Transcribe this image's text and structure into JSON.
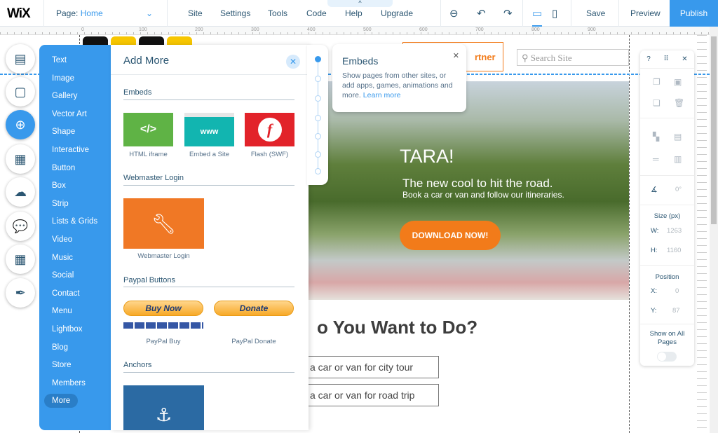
{
  "topbar": {
    "logo": "WiX",
    "page_label": "Page:",
    "page_value": "Home",
    "menu": [
      "Site",
      "Settings",
      "Tools",
      "Code",
      "Help",
      "Upgrade"
    ],
    "save": "Save",
    "preview": "Preview",
    "publish": "Publish",
    "accent": "#3899ec"
  },
  "ruler": [
    "0",
    "100",
    "200",
    "300",
    "400",
    "500",
    "600",
    "700",
    "800",
    "900"
  ],
  "add_panel": {
    "title": "Add More",
    "categories": [
      "Text",
      "Image",
      "Gallery",
      "Vector Art",
      "Shape",
      "Interactive",
      "Button",
      "Box",
      "Strip",
      "Lists & Grids",
      "Video",
      "Music",
      "Social",
      "Contact",
      "Menu",
      "Lightbox",
      "Blog",
      "Store",
      "Members",
      "More"
    ],
    "sections": {
      "embeds": "Embeds",
      "webmaster": "Webmaster Login",
      "paypal": "Paypal Buttons",
      "anchors": "Anchors"
    },
    "embeds": [
      {
        "icon": "</>",
        "label": "HTML iframe"
      },
      {
        "icon": "www",
        "label": "Embed a Site"
      },
      {
        "icon": "f",
        "label": "Flash (SWF)"
      }
    ],
    "webmaster_item": "Webmaster Login",
    "paypal": [
      {
        "button": "Buy Now",
        "label": "PayPal Buy"
      },
      {
        "button": "Donate",
        "label": "PayPal Donate"
      }
    ]
  },
  "tooltip": {
    "title": "Embeds",
    "body": "Show pages from other sites, or add apps, games, animations and more.",
    "link": "Learn more"
  },
  "site": {
    "partner": "rtner",
    "search_placeholder": "Search Site",
    "hero_title": "TARA!",
    "hero_sub": "The new cool to hit the road.",
    "hero_sub2": "Book a car or van and follow our itineraries.",
    "cta": "DOWNLOAD NOW!",
    "question": "o You Want to Do?",
    "choices": [
      "a car or van for city tour",
      "a car or van for road trip"
    ]
  },
  "inspector": {
    "help": "?",
    "size_label": "Size (px)",
    "w_label": "W:",
    "w": "1263",
    "h_label": "H:",
    "h": "1160",
    "rotation": "0°",
    "position_label": "Position",
    "x_label": "X:",
    "x": "0",
    "y_label": "Y:",
    "y": "87",
    "show_all": "Show on All Pages",
    "show_all_on": false
  }
}
